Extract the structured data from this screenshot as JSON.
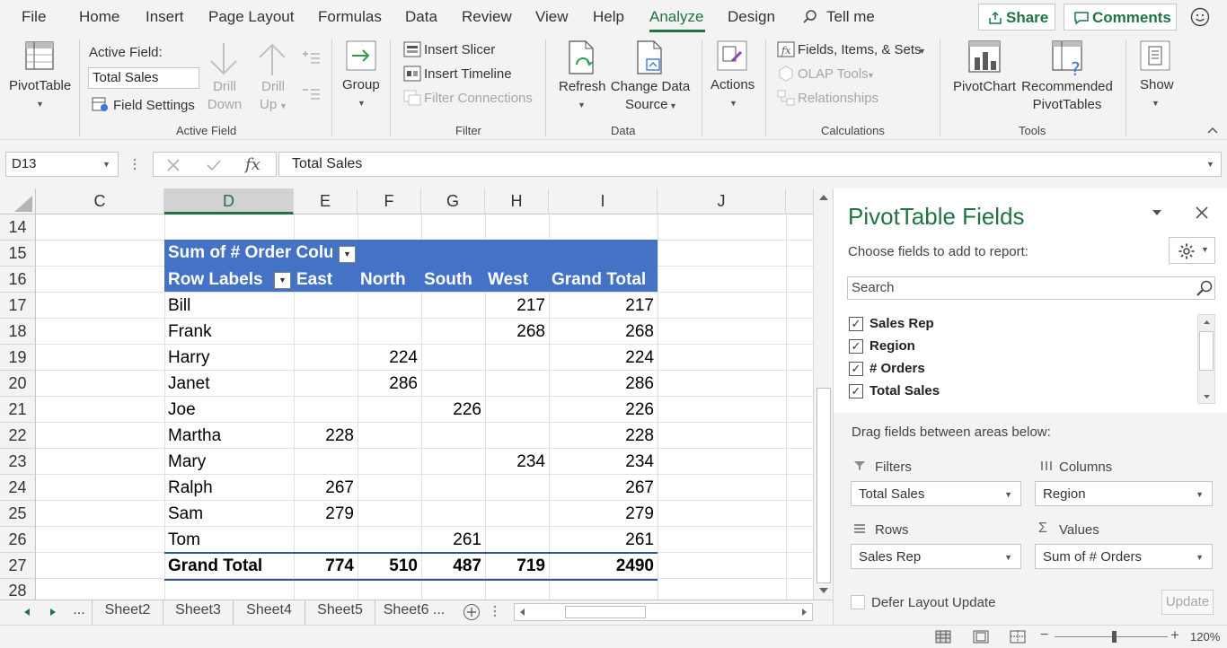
{
  "menu": {
    "tabs": [
      "File",
      "Home",
      "Insert",
      "Page Layout",
      "Formulas",
      "Data",
      "Review",
      "View",
      "Help",
      "Analyze",
      "Design"
    ],
    "tell_me": "Tell me",
    "share": "Share",
    "comments": "Comments"
  },
  "ribbon": {
    "pivottable": "PivotTable",
    "active_field_label": "Active Field:",
    "active_field_value": "Total Sales",
    "field_settings": "Field Settings",
    "drill_down": [
      "Drill",
      "Down"
    ],
    "drill_up": [
      "Drill",
      "Up"
    ],
    "active_field_group": "Active Field",
    "group": "Group",
    "insert_slicer": "Insert Slicer",
    "insert_timeline": "Insert Timeline",
    "filter_connections": "Filter Connections",
    "filter_group": "Filter",
    "refresh": "Refresh",
    "change_data_source": [
      "Change Data",
      "Source"
    ],
    "data_group": "Data",
    "actions": "Actions",
    "fields_items_sets": "Fields, Items, & Sets",
    "olap_tools": "OLAP Tools",
    "relationships": "Relationships",
    "calculations_group": "Calculations",
    "pivotchart": "PivotChart",
    "recommended": [
      "Recommended",
      "PivotTables"
    ],
    "tools_group": "Tools",
    "show": "Show"
  },
  "formula_bar": {
    "name_box": "D13",
    "formula": "Total Sales"
  },
  "grid": {
    "columns": [
      "C",
      "D",
      "E",
      "F",
      "G",
      "H",
      "I",
      "J"
    ],
    "rows": [
      "14",
      "15",
      "16",
      "17",
      "18",
      "19",
      "20",
      "21",
      "22",
      "23",
      "24",
      "25",
      "26",
      "27",
      "28"
    ]
  },
  "pivot": {
    "title": "Sum of # Order Colur",
    "row_labels": "Row Labels",
    "headers": [
      "East",
      "North",
      "South",
      "West",
      "Grand Total"
    ],
    "rows": [
      {
        "name": "Bill",
        "east": "",
        "north": "",
        "south": "",
        "west": "217",
        "total": "217"
      },
      {
        "name": "Frank",
        "east": "",
        "north": "",
        "south": "",
        "west": "268",
        "total": "268"
      },
      {
        "name": "Harry",
        "east": "",
        "north": "224",
        "south": "",
        "west": "",
        "total": "224"
      },
      {
        "name": "Janet",
        "east": "",
        "north": "286",
        "south": "",
        "west": "",
        "total": "286"
      },
      {
        "name": "Joe",
        "east": "",
        "north": "",
        "south": "226",
        "west": "",
        "total": "226"
      },
      {
        "name": "Martha",
        "east": "228",
        "north": "",
        "south": "",
        "west": "",
        "total": "228"
      },
      {
        "name": "Mary",
        "east": "",
        "north": "",
        "south": "",
        "west": "234",
        "total": "234"
      },
      {
        "name": "Ralph",
        "east": "267",
        "north": "",
        "south": "",
        "west": "",
        "total": "267"
      },
      {
        "name": "Sam",
        "east": "279",
        "north": "",
        "south": "",
        "west": "",
        "total": "279"
      },
      {
        "name": "Tom",
        "east": "",
        "north": "",
        "south": "261",
        "west": "",
        "total": "261"
      }
    ],
    "grand_total": {
      "name": "Grand Total",
      "east": "774",
      "north": "510",
      "south": "487",
      "west": "719",
      "total": "2490"
    }
  },
  "sheets": {
    "ellipsis": "...",
    "tabs": [
      "Sheet2",
      "Sheet3",
      "Sheet4",
      "Sheet5",
      "Sheet6 ..."
    ]
  },
  "status": {
    "zoom": "120%"
  },
  "panel": {
    "title": "PivotTable Fields",
    "choose": "Choose fields to add to report:",
    "search_placeholder": "Search",
    "fields": [
      "Sales Rep",
      "Region",
      "# Orders",
      "Total Sales"
    ],
    "drag_text": "Drag fields between areas below:",
    "filters": "Filters",
    "columns": "Columns",
    "rows": "Rows",
    "values": "Values",
    "filters_value": "Total Sales",
    "columns_value": "Region",
    "rows_value": "Sales Rep",
    "values_value": "Sum of # Orders",
    "defer": "Defer Layout Update",
    "update": "Update"
  },
  "colors": {
    "accent": "#217346",
    "pivot_header": "#4472c4"
  }
}
